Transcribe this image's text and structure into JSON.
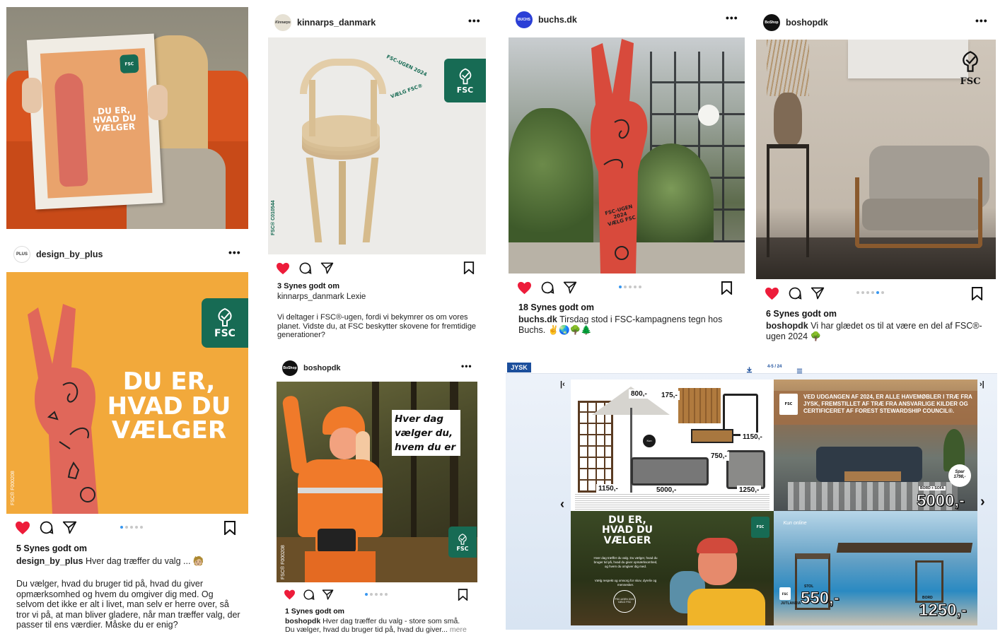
{
  "posts": {
    "p_newspaper": {
      "headline": "DU ER,\nHVAD DU\nVÆLGER"
    },
    "p_design": {
      "username": "design_by_plus",
      "avatar_text": "PLUS",
      "headline": "DU ER,\nHVAD DU\nVÆLGER",
      "fsc_code": "FSC® F000208",
      "likes": "5 Synes godt om",
      "caption_user": "design_by_plus",
      "caption_first": "Hver dag træffer du valg ... 🧑🏼",
      "caption_body": "Du vælger, hvad du bruger tid på, hvad du giver opmærksomhed og hvem du omgiver dig med. Og selvom det ikke er alt i livet, man selv er herre over, så tror vi på, at man bliver gladere, når man træffer valg, der passer til ens værdier. Måske du er enig?"
    },
    "p_kinnarps": {
      "username": "kinnarps_danmark",
      "avatar_text": "Kinnarps",
      "badge_top": "FSC-UGEN 2024",
      "badge_bottom": "VÆLG FSC®",
      "fsc_code": "FSC® C010544",
      "likes": "3 Synes godt om",
      "caption_user": "kinnarps_danmark",
      "caption_first": "Lexie",
      "caption_body": "Vi deltager i FSC®-ugen, fordi vi bekymrer os om vores planet. Vidste du, at FSC beskytter skovene for fremtidige generationer?"
    },
    "p_boshop_small": {
      "username": "boshopdk",
      "avatar_text": "BoShop",
      "speech": "Hver dag\nvælger du,\nhvem du er",
      "fsc_code": "FSC® F000208",
      "likes": "1 Synes godt om",
      "caption_user": "boshopdk",
      "caption_first": "Hver dag træffer du valg - store som små.",
      "caption_second": "Du vælger, hvad du bruger tid på, hvad du giver...",
      "more": "mere"
    },
    "p_buchs": {
      "username": "buchs.dk",
      "avatar_text": "BUCHS",
      "arm_text": "FSC-UGEN 2024\nVÆLG FSC",
      "likes": "18 Synes godt om",
      "caption_user": "buchs.dk",
      "caption_first": "Tirsdag stod i FSC-kampagnens tegn hos Buchs. ✌️🌏🌳🌲"
    },
    "p_boshop_big": {
      "username": "boshopdk",
      "avatar_text": "BoShop",
      "likes": "6 Synes godt om",
      "caption_user": "boshopdk",
      "caption_first": "Vi har glædet os til at være en del af FSC®-ugen 2024 🌳"
    }
  },
  "fsc_label": "FSC",
  "jysk": {
    "logo": "JYSK",
    "page_indicator": "4-5 / 24",
    "banner": "VED UDGANGEN AF 2024, ER ALLE HAVEMØBLER I TRÆ FRA JYSK, FREMSTILLET AF TRÆ FRA ANSVARLIGE KILDER OG CERTIFICERET AF FOREST STEWARDSHIP COUNCIL®.",
    "prices_left": [
      "800,-",
      "175,-",
      "1150,-",
      "750,-",
      "5000,-",
      "1250,-",
      "1150,-"
    ],
    "kun_online": "Kun online",
    "spar": "Spar 1798,-",
    "bord_sofa": "BORD + SOFA",
    "price_bordsofa": "5000,-",
    "stol": "STOL",
    "price_stol": "550,-",
    "bord": "BORD",
    "price_bord": "1250,-",
    "jutlandia": "JUTLANDIA",
    "ad_headline": "DU ER,\nHVAD DU\nVÆLGER",
    "ad_body": "Hver dag træffer du valg. Du vælger, hvad du bruger tid på, hvad du giver opmærksomhed, og hvem du omgiver dig med.",
    "ad_body2": "Vælg respekt og omsorg for skov, dyreliv og mennesker.",
    "ad_badge": "FSC-UGEN 2024 VÆLG FSC"
  },
  "colors": {
    "fsc_green": "#176b54",
    "campaign_orange": "#f2a93b",
    "campaign_red": "#e0675a",
    "like_red": "#ed1c3a",
    "jysk_blue": "#1c4f9c"
  }
}
